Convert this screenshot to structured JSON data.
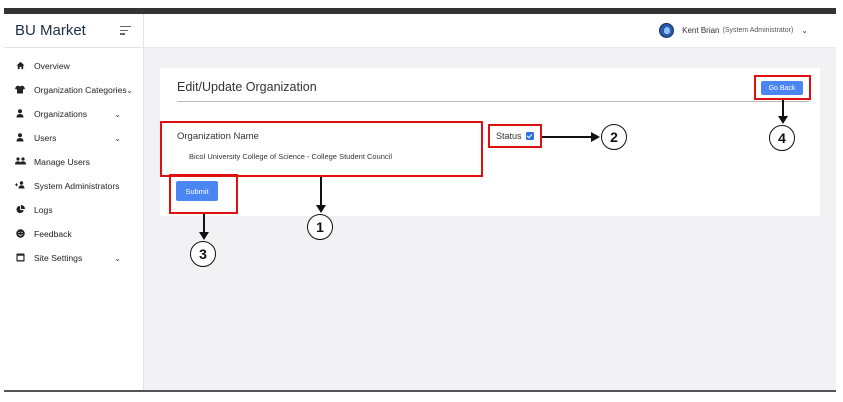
{
  "app": {
    "brand": "BU Market"
  },
  "header": {
    "user_name": "Kent Brian",
    "user_role": "(System Administrator)"
  },
  "sidebar": {
    "items": [
      {
        "label": "Overview",
        "icon": "home-icon",
        "has_dropdown": false
      },
      {
        "label": "Organization Categories",
        "icon": "shirt-icon",
        "has_dropdown": true
      },
      {
        "label": "Organizations",
        "icon": "user-icon",
        "has_dropdown": true
      },
      {
        "label": "Users",
        "icon": "user-icon",
        "has_dropdown": true
      },
      {
        "label": "Manage Users",
        "icon": "users-icon",
        "has_dropdown": false
      },
      {
        "label": "System Administrators",
        "icon": "user-plus-icon",
        "has_dropdown": false
      },
      {
        "label": "Logs",
        "icon": "pie-chart-icon",
        "has_dropdown": false
      },
      {
        "label": "Feedback",
        "icon": "smile-icon",
        "has_dropdown": false
      },
      {
        "label": "Site Settings",
        "icon": "window-icon",
        "has_dropdown": true
      }
    ]
  },
  "main": {
    "card_title": "Edit/Update Organization",
    "go_back_label": "Go Back",
    "org_name_label": "Organization Name",
    "org_name_value": "Bicol University College of Science - College Student Council",
    "status_label": "Status",
    "status_checked": true,
    "submit_label": "Submit"
  },
  "annotations": {
    "callout_1": "1",
    "callout_2": "2",
    "callout_3": "3",
    "callout_4": "4",
    "highlight_color": "#e01010"
  },
  "colors": {
    "primary_button": "#4a86f2",
    "content_background": "#f2f2f4"
  }
}
